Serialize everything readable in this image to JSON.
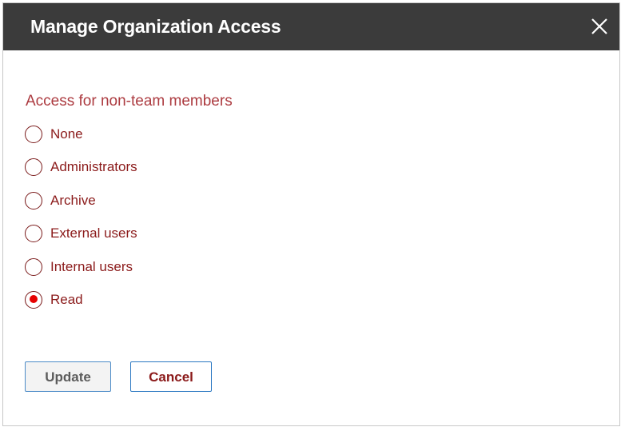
{
  "dialog": {
    "title": "Manage Organization Access",
    "close_icon": "close-icon"
  },
  "access": {
    "heading": "Access for non-team members",
    "options": [
      {
        "label": "None",
        "checked": false
      },
      {
        "label": "Administrators",
        "checked": false
      },
      {
        "label": "Archive",
        "checked": false
      },
      {
        "label": "External users",
        "checked": false
      },
      {
        "label": "Internal users",
        "checked": false
      },
      {
        "label": "Read",
        "checked": true
      }
    ]
  },
  "buttons": {
    "update_label": "Update",
    "cancel_label": "Cancel"
  },
  "colors": {
    "header_bg": "#3b3b3b",
    "accent_text": "#8b1a1a",
    "radio_selected": "#e60000",
    "button_border": "#2b78c2"
  }
}
